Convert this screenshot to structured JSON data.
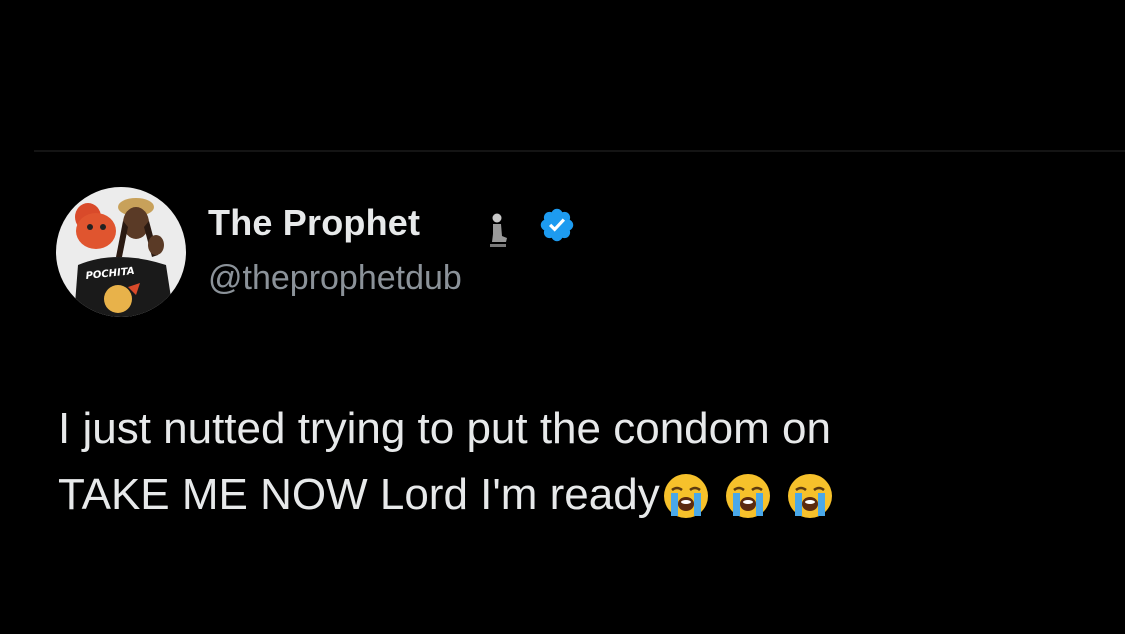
{
  "tweet": {
    "author": {
      "display_name": "The Prophet",
      "name_emoji": "person-kneeling-praying-emoji",
      "verified": true,
      "handle": "@theprophetdub",
      "avatar_shirt_text": "POCHITA"
    },
    "text_lines": [
      "I just nutted trying to put the condom on",
      "TAKE ME NOW Lord I'm ready"
    ],
    "trailing_emojis": [
      "loudly-crying-face-emoji",
      "loudly-crying-face-emoji",
      "loudly-crying-face-emoji"
    ]
  },
  "colors": {
    "background": "#000000",
    "text_primary": "#e7e9ea",
    "text_secondary": "#8b9299",
    "verified_blue": "#1d9bf0"
  }
}
